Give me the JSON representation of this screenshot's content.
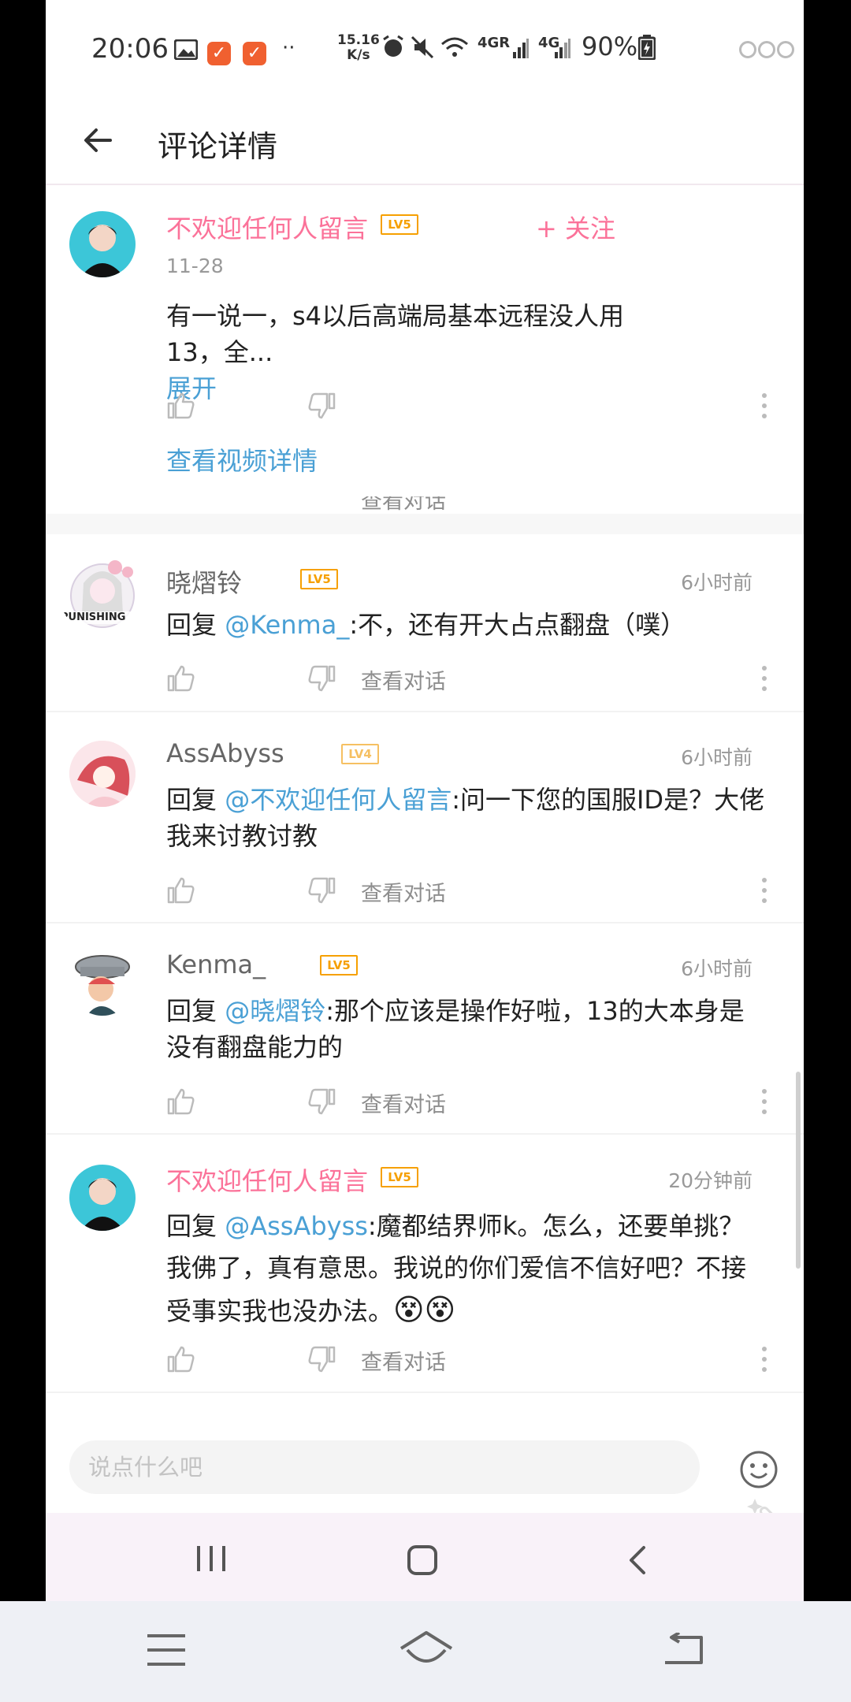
{
  "status_bar": {
    "time": "20:06",
    "speed_value": "15.16",
    "speed_unit": "K/s",
    "net1": "4GR",
    "net2": "4G",
    "battery": "90%"
  },
  "header": {
    "title": "评论详情"
  },
  "main_comment": {
    "username": "不欢迎任何人留言",
    "level": "LV5",
    "follow_label": "+ 关注",
    "date": "11-28",
    "text": "有一说一，s4以后高端局基本远程没人用13，全...",
    "expand_label": "展开",
    "view_video_label": "查看视频详情",
    "clipped_conversation_label": "查看对话"
  },
  "replies": [
    {
      "username": "晓熠铃",
      "level": "LV5",
      "time": "6小时前",
      "reply_prefix": "回复",
      "mention": "@Kenma_",
      "text": ":不，还有开大占点翻盘（噗）",
      "conversation_label": "查看对话",
      "avatar_badge": "PUNISHING"
    },
    {
      "username": "AssAbyss",
      "level": "LV4",
      "time": "6小时前",
      "reply_prefix": "回复",
      "mention": "@不欢迎任何人留言",
      "text": ":问一下您的国服ID是？大佬我来讨教讨教",
      "conversation_label": "查看对话"
    },
    {
      "username": "Kenma_",
      "level": "LV5",
      "time": "6小时前",
      "reply_prefix": "回复",
      "mention": "@晓熠铃",
      "text": ":那个应该是操作好啦，13的大本身是没有翻盘能力的",
      "conversation_label": "查看对话"
    },
    {
      "username": "不欢迎任何人留言",
      "level": "LV5",
      "time": "20分钟前",
      "reply_prefix": "回复",
      "mention": "@AssAbyss",
      "text": ":魔都结界师k。怎么，还要单挑？我佛了，真有意思。我说的你们爱信不信好吧？不接受事实我也没办法。",
      "emoji": "😵😵",
      "conversation_label": "查看对话"
    }
  ],
  "input": {
    "placeholder": "说点什么吧"
  },
  "colors": {
    "accent_pink": "#fb7299",
    "link_blue": "#4aa0d5",
    "level_orange": "#f6a000"
  }
}
